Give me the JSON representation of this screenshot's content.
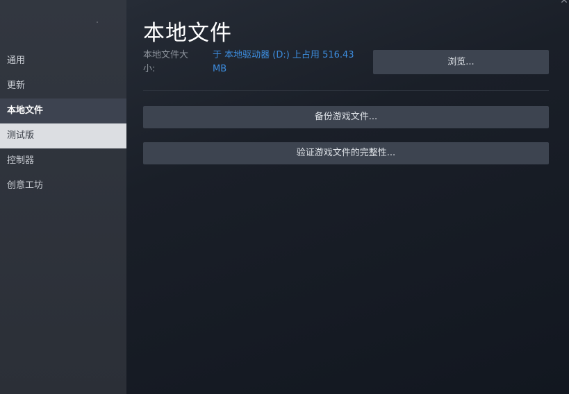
{
  "sidebar": {
    "items": [
      {
        "label": "通用",
        "state": "normal"
      },
      {
        "label": "更新",
        "state": "normal"
      },
      {
        "label": "本地文件",
        "state": "active"
      },
      {
        "label": "测试版",
        "state": "hover"
      },
      {
        "label": "控制器",
        "state": "normal"
      },
      {
        "label": "创意工坊",
        "state": "normal"
      }
    ]
  },
  "main": {
    "title": "本地文件",
    "size_label": "本地文件大小:",
    "size_value": "于 本地驱动器 (D:) 上占用 516.43 MB",
    "browse_label": "浏览...",
    "backup_label": "备份游戏文件...",
    "verify_label": "验证游戏文件的完整性..."
  },
  "window": {
    "close_icon": "close-icon"
  },
  "colors": {
    "accent_link": "#3d8ee0",
    "active_nav_bg": "#3d4350",
    "hover_nav_bg": "#dcdee2",
    "button_bg": "#3d4450"
  }
}
